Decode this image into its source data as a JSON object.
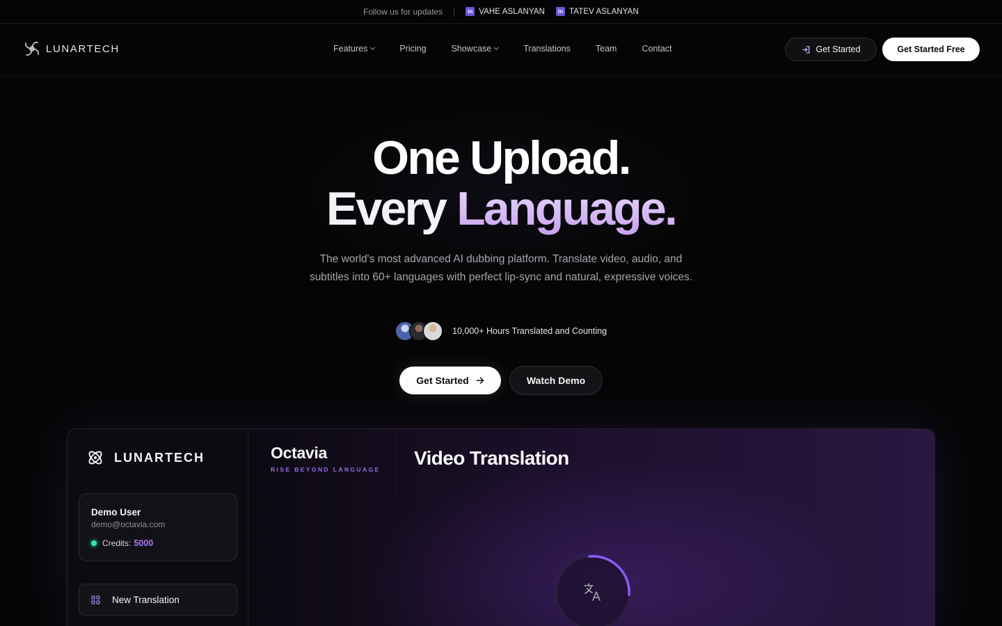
{
  "topbar": {
    "follow_text": "Follow us for updates",
    "links": [
      {
        "label": "VAHE ASLANYAN",
        "icon": "linkedin-icon"
      },
      {
        "label": "TATEV ASLANYAN",
        "icon": "linkedin-icon"
      }
    ]
  },
  "nav": {
    "logo_text": "LUNARTECH",
    "links": [
      {
        "label": "Features",
        "dropdown": true
      },
      {
        "label": "Pricing",
        "dropdown": false
      },
      {
        "label": "Showcase",
        "dropdown": true
      },
      {
        "label": "Translations",
        "dropdown": false
      },
      {
        "label": "Team",
        "dropdown": false
      },
      {
        "label": "Contact",
        "dropdown": false
      }
    ],
    "signin_label": "Get Started",
    "primary_label": "Get Started Free"
  },
  "hero": {
    "line1": "One Upload.",
    "line2_plain": "Every ",
    "line2_accent": "Language.",
    "subtitle": "The world's most advanced AI dubbing platform. Translate video, audio, and subtitles into 60+ languages with perfect lip-sync and natural, expressive voices.",
    "social_proof": "10,000+ Hours Translated and Counting",
    "cta_primary": "Get Started",
    "cta_secondary": "Watch Demo"
  },
  "preview": {
    "logo_text": "LUNARTECH",
    "user": {
      "name": "Demo User",
      "email": "demo@octavia.com",
      "credits_label": "Credits:",
      "credits_value": "5000"
    },
    "new_translation_label": "New Translation",
    "brand_name": "Octavia",
    "brand_tagline": "RISE BEYOND LANGUAGE",
    "main_title": "Video Translation"
  },
  "colors": {
    "accent_purple": "#9b6cf0",
    "linkedin_badge": "#6e54d8",
    "status_green": "#2ee6a8"
  }
}
